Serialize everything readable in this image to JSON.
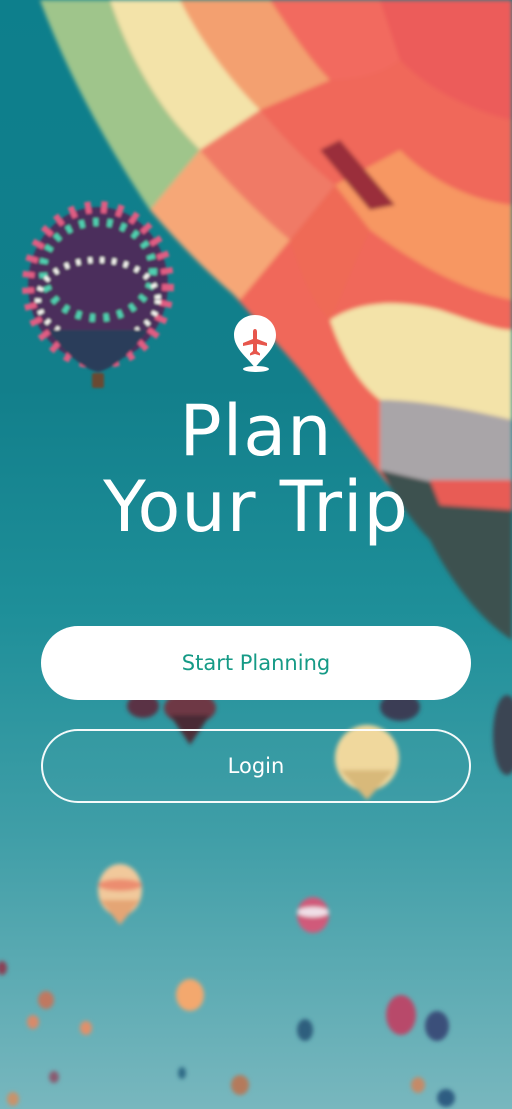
{
  "app": {
    "title_line1": "Plan",
    "title_line2": "Your Trip",
    "logo_icon": "map-pin-airplane-icon"
  },
  "buttons": {
    "primary_label": "Start Planning",
    "secondary_label": "Login"
  },
  "colors": {
    "accent": "#159a86",
    "sky_top": "#0d7f8c",
    "sky_bottom": "#78b7be",
    "plane": "#e7564c"
  }
}
